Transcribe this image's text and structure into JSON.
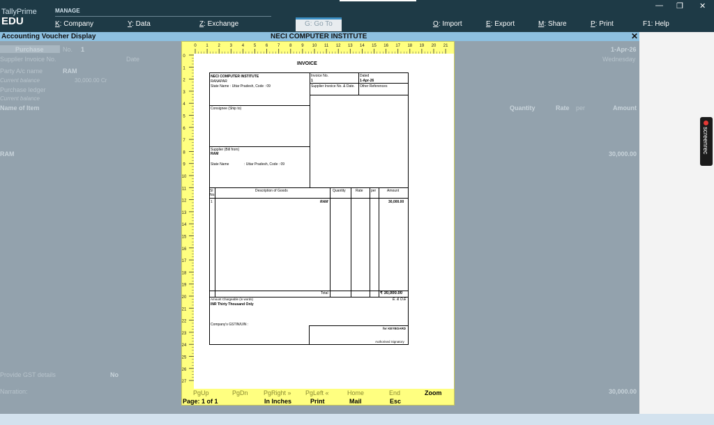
{
  "app": {
    "name": "TallyPrime",
    "edition": "EDU"
  },
  "menu": {
    "manage_label": "MANAGE",
    "items": [
      {
        "key": "K",
        "label": ": Company"
      },
      {
        "key": "Y",
        "label": ": Data"
      },
      {
        "key": "Z",
        "label": ": Exchange"
      },
      {
        "key": "G",
        "label": ": Go To"
      },
      {
        "key": "O",
        "label": ": Import"
      },
      {
        "key": "E",
        "label": ": Export"
      },
      {
        "key": "M",
        "label": ": Share"
      },
      {
        "key": "P",
        "label": ": Print"
      },
      {
        "key": "F1",
        "label": ": Help"
      }
    ]
  },
  "window": {
    "minimize": "—",
    "restore": "❐",
    "close": "✕"
  },
  "screen": {
    "title": "Accounting Voucher Display",
    "company": "NECI COMPUTER INSTITUTE",
    "close": "✕"
  },
  "background": {
    "voucher_type": "Purchase",
    "no_label": "No.",
    "no_value": "1",
    "date": "1-Apr-26",
    "day": "Wednesday",
    "supplier_invoice_label": "Supplier Invoice No.",
    "date_label": "Date",
    "party_label": "Party A/c name",
    "party_value": "RAM",
    "current_balance_label": "Current balance",
    "current_balance_value": "30,000.00 Cr",
    "purchase_ledger_label": "Purchase ledger",
    "current_balance_label2": "Current balance",
    "name_of_item": "Name of Item",
    "quantity": "Quantity",
    "rate": "Rate",
    "per": "per",
    "amount": "Amount",
    "item_name": "RAM",
    "item_amount": "30,000.00",
    "gst_label": "Provide GST details",
    "gst_value": "No",
    "narration_label": "Narration:",
    "total": "30,000.00"
  },
  "screenrec": {
    "label": "screenrec"
  },
  "ruler": {
    "top": [
      "0",
      "1",
      "2",
      "3",
      "4",
      "5",
      "6",
      "7",
      "8",
      "9",
      "10",
      "11",
      "12",
      "13",
      "14",
      "15",
      "16",
      "17",
      "18",
      "19",
      "20",
      "21"
    ],
    "left": [
      "0",
      "1",
      "2",
      "3",
      "4",
      "5",
      "6",
      "7",
      "8",
      "9",
      "10",
      "11",
      "12",
      "13",
      "14",
      "15",
      "16",
      "17",
      "18",
      "19",
      "20",
      "21",
      "22",
      "23",
      "24",
      "25",
      "26",
      "27"
    ]
  },
  "invoice": {
    "title": "INVOICE",
    "seller_name": "NECI COMPUTER INSTITUTE",
    "seller_city": "RANAPAR",
    "seller_state": "State Name :  Uttar Pradesh, Code : 09",
    "invoice_no_label": "Invoice No.",
    "invoice_no": "1",
    "dated_label": "Dated",
    "dated": "1-Apr-26",
    "supplier_inv_label": "Supplier Invoice No. & Date.",
    "other_ref_label": "Other References",
    "consignee_label": "Consignee (Ship to)",
    "supplier_label": "Supplier (Bill from)",
    "supplier_name": "RAM",
    "supplier_state_label": "State Name",
    "supplier_state": ": Uttar Pradesh, Code : 09",
    "col_sl": "Sl",
    "col_no": "No.",
    "col_desc": "Description of Goods",
    "col_qty": "Quantity",
    "col_rate": "Rate",
    "col_per": "per",
    "col_amount": "Amount",
    "row_sl": "1",
    "row_desc": "RAM",
    "row_amount": "30,000.00",
    "total_label": "Total",
    "total_amount": "₹ 30,000.00",
    "words_label": "Amount Chargeable (in words)",
    "eoe": "E. & O.E",
    "words": "INR Thirty Thousand Only",
    "gstin_label": "Company's GSTIN/UIN   :",
    "for_label": "for KEYBOARD",
    "signatory": "Authorised Signatory"
  },
  "preview_footer": {
    "keys": [
      "PgUp",
      "PgDn",
      "PgRight »",
      "PgLeft «",
      "Home",
      "End",
      "Zoom"
    ],
    "values": [
      "Page: 1 of 1",
      "",
      "In Inches",
      "Print",
      "Mail",
      "Esc",
      ""
    ]
  }
}
